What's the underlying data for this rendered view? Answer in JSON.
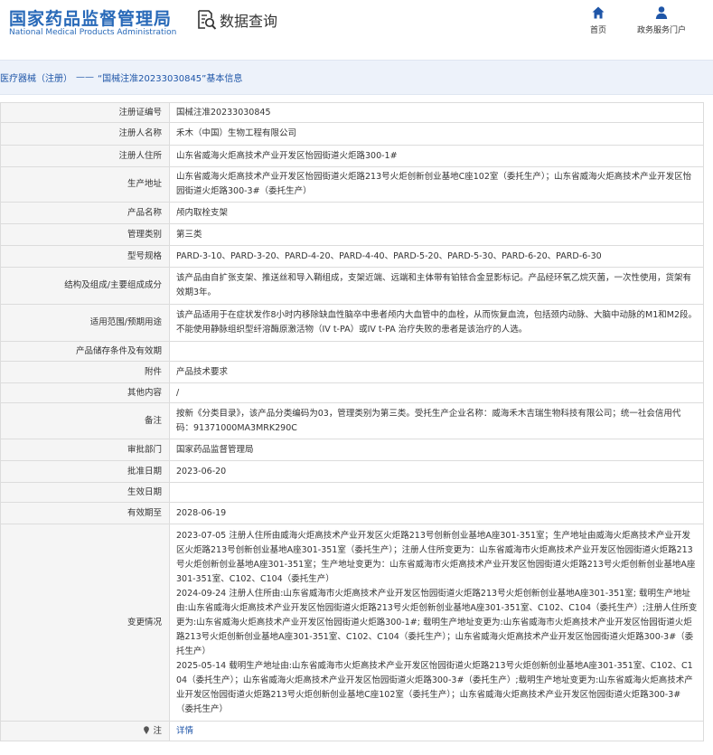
{
  "header": {
    "logo_cn": "国家药品监督管理局",
    "logo_en": "National Medical Products Administration",
    "query_title": "数据查询",
    "nav": [
      {
        "label": "首页",
        "icon": "home-icon"
      },
      {
        "label": "政务服务门户",
        "icon": "person-icon"
      }
    ]
  },
  "breadcrumb": {
    "link": "医疗器械（注册）",
    "separator": "——",
    "current": "“国械注准20233030845”基本信息"
  },
  "colors": {
    "brand_blue": "#2869b8",
    "link_blue": "#1f56a8",
    "breadcrumb_bg": "#edf2fa",
    "label_bg": "#f5f5f5",
    "border": "#dcdcdc"
  },
  "rows": [
    {
      "label": "注册证编号",
      "value": "国械注准20233030845"
    },
    {
      "label": "注册人名称",
      "value": "禾木（中国）生物工程有限公司"
    },
    {
      "label": "注册人住所",
      "value": "山东省威海火炬高技术产业开发区怡园街道火炬路300-1#"
    },
    {
      "label": "生产地址",
      "value": "山东省威海火炬高技术产业开发区怡园街道火炬路213号火炬创新创业基地C座102室（委托生产）；山东省威海火炬高技术产业开发区怡园街道火炬路300-3#（委托生产）"
    },
    {
      "label": "产品名称",
      "value": "颅内取栓支架"
    },
    {
      "label": "管理类别",
      "value": "第三类"
    },
    {
      "label": "型号规格",
      "value": "PARD-3-10、PARD-3-20、PARD-4-20、PARD-4-40、PARD-5-20、PARD-5-30、PARD-6-20、PARD-6-30"
    },
    {
      "label": "结构及组成/主要组成成分",
      "value": "该产品由自扩张支架、推送丝和导入鞘组成，支架近端、远端和主体带有铂铱合金显影标记。产品经环氧乙烷灭菌，一次性使用，货架有效期3年。"
    },
    {
      "label": "适用范围/预期用途",
      "value": "该产品适用于在症状发作8小时内移除缺血性脑卒中患者颅内大血管中的血栓，从而恢复血流，包括颈内动脉、大脑中动脉的M1和M2段。不能使用静脉组织型纤溶酶原激活物（IV t-PA）或IV t-PA 治疗失败的患者是该治疗的人选。"
    },
    {
      "label": "产品储存条件及有效期",
      "value": ""
    },
    {
      "label": "附件",
      "value": "产品技术要求"
    },
    {
      "label": "其他内容",
      "value": "/"
    },
    {
      "label": "备注",
      "value": "按新《分类目录》，该产品分类编码为03，管理类别为第三类。受托生产企业名称：威海禾木吉瑞生物科技有限公司；统一社会信用代码：91371000MA3MRK290C"
    },
    {
      "label": "审批部门",
      "value": "国家药品监督管理局"
    },
    {
      "label": "批准日期",
      "value": "2023-06-20"
    },
    {
      "label": "生效日期",
      "value": ""
    },
    {
      "label": "有效期至",
      "value": "2028-06-19"
    },
    {
      "label": "变更情况",
      "value": "2023-07-05 注册人住所由威海火炬高技术产业开发区火炬路213号创新创业基地A座301-351室；生产地址由威海火炬高技术产业开发区火炬路213号创新创业基地A座301-351室（委托生产）；注册人住所变更为：山东省威海市火炬高技术产业开发区怡园街道火炬路213号火炬创新创业基地A座301-351室；生产地址变更为：山东省威海市火炬高技术产业开发区怡园街道火炬路213号火炬创新创业基地A座301-351室、C102、C104（委托生产）\n2024-09-24 注册人住所由:山东省威海市火炬高技术产业开发区怡园街道火炬路213号火炬创新创业基地A座301-351室; 载明生产地址由:山东省威海火炬高技术产业开发区怡园街道火炬路213号火炬创新创业基地A座301-351室、C102、C104（委托生产）;注册人住所变更为:山东省威海火炬高技术产业开发区怡园街道火炬路300-1#; 载明生产地址变更为:山东省威海市火炬高技术产业开发区怡园街道火炬路213号火炬创新创业基地A座301-351室、C102、C104（委托生产）；山东省威海火炬高技术产业开发区怡园街道火炬路300-3#（委托生产）\n2025-05-14 载明生产地址由:山东省威海市火炬高技术产业开发区怡园街道火炬路213号火炬创新创业基地A座301-351室、C102、C104（委托生产）；山东省威海火炬高技术产业开发区怡园街道火炬路300-3#（委托生产）;载明生产地址变更为:山东省威海火炬高技术产业开发区怡园街道火炬路213号火炬创新创业基地C座102室（委托生产）；山东省威海火炬高技术产业开发区怡园街道火炬路300-3#（委托生产）"
    }
  ],
  "note": {
    "label": "注",
    "link": "详情"
  }
}
